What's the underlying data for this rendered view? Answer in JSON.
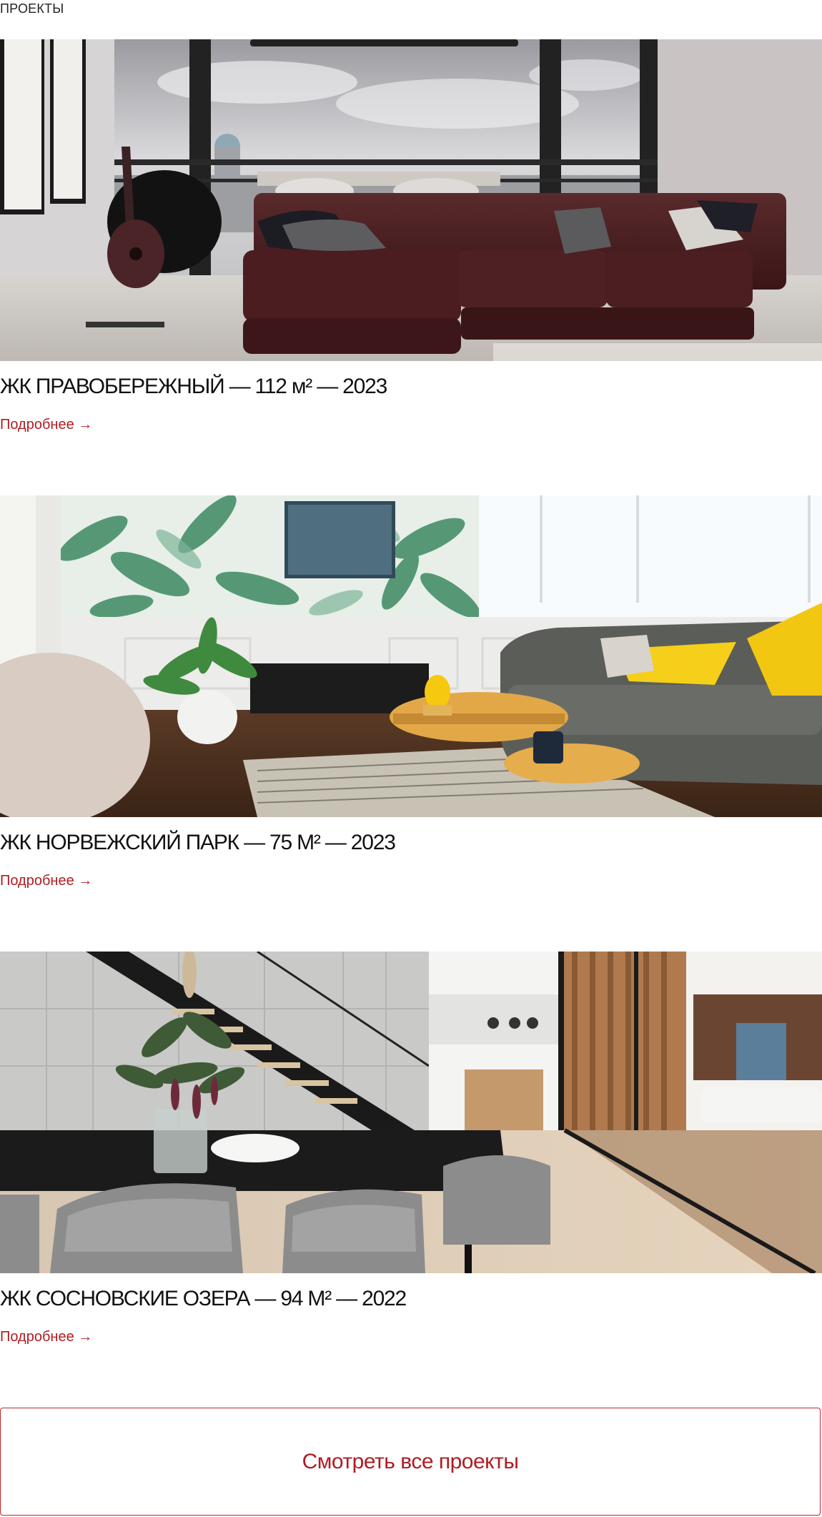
{
  "section": {
    "label": "ПРОЕКТЫ"
  },
  "projects": [
    {
      "title": "ЖК ПРАВОБЕРЕЖНЫЙ — 112 м² — 2023",
      "link_label": "Подробнее →"
    },
    {
      "title": "ЖК НОРВЕЖСКИЙ ПАРК — 75 М² — 2023",
      "link_label": "Подробнее →"
    },
    {
      "title": "ЖК СОСНОВСКИЕ ОЗЕРА — 94 М² — 2022",
      "link_label": "Подробнее →"
    }
  ],
  "all_projects_button": {
    "label": "Смотреть все проекты"
  },
  "colors": {
    "accent": "#b01c22",
    "border": "#c0282d",
    "text": "#111111"
  }
}
